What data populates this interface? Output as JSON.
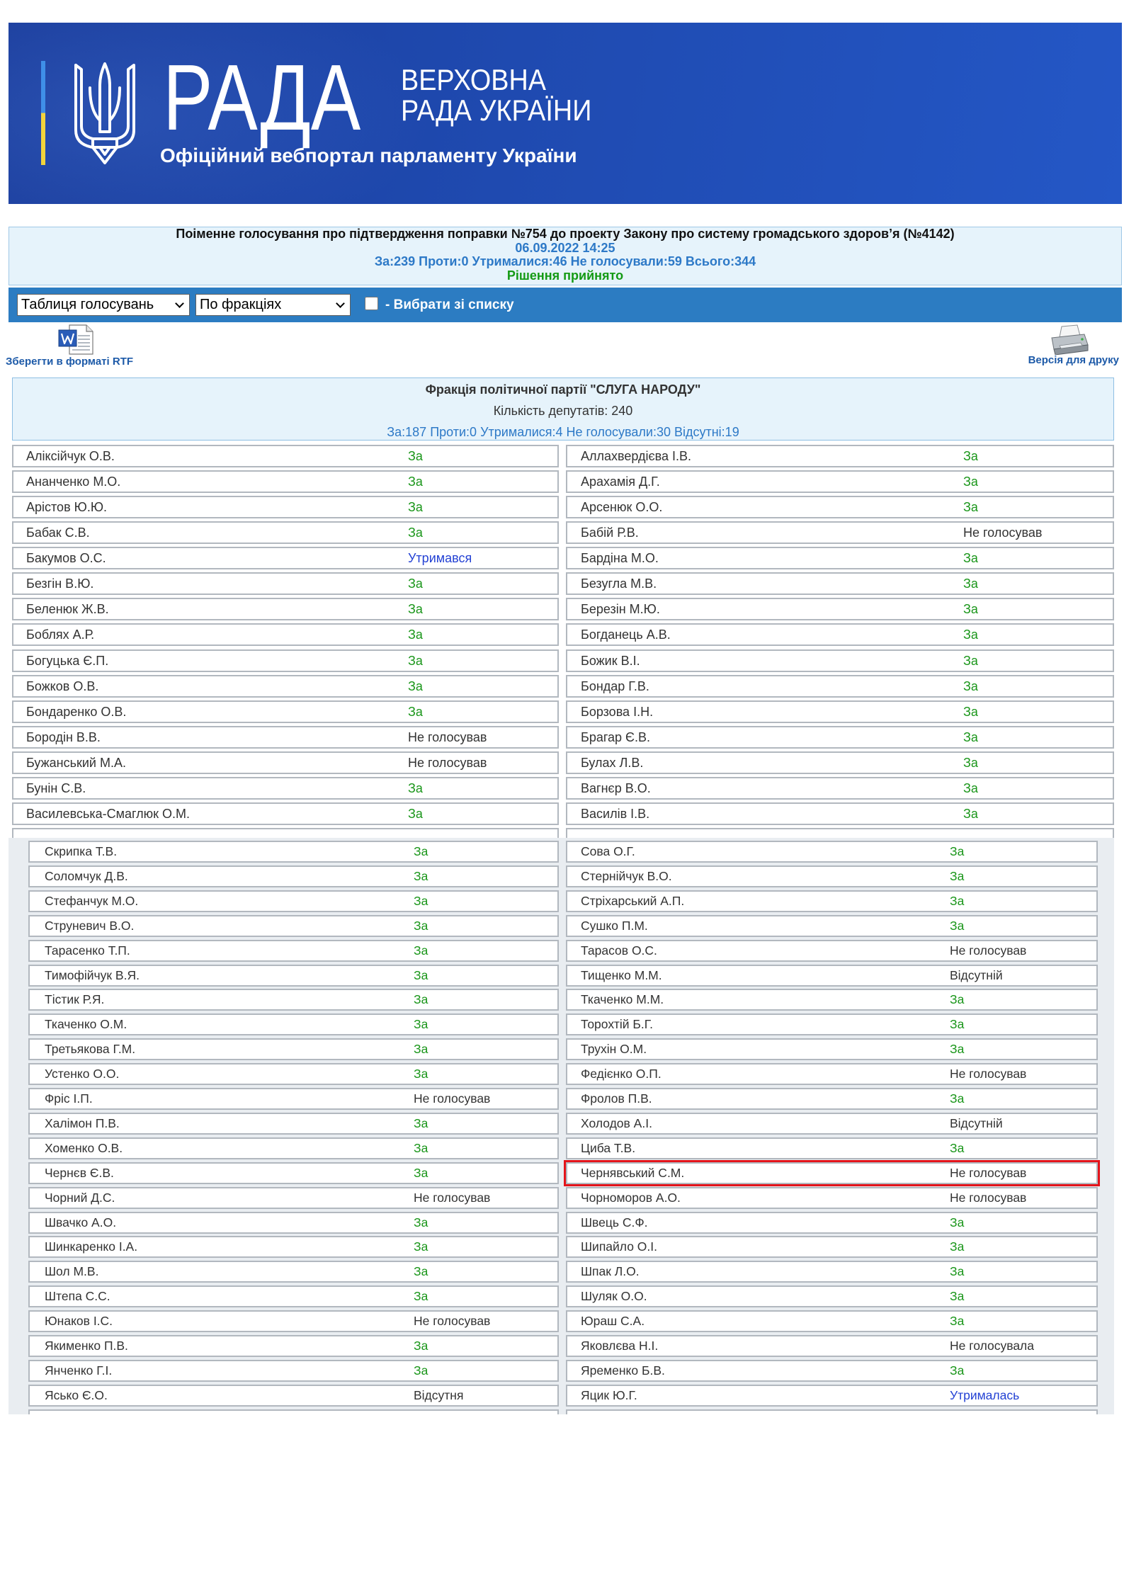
{
  "header": {
    "logo_text": "РАДА",
    "subtitle_line1": "ВЕРХОВНА",
    "subtitle_line2": "РАДА УКРАЇНИ",
    "tagline": "Офіційний вебпортал парламенту України"
  },
  "vote_summary": {
    "title": "Поіменне голосування про підтвердження поправки №754 до проекту Закону про систему громадського здоров’я (№4142)",
    "datetime": "06.09.2022 14:25",
    "totals": "За:239 Проти:0 Утрималися:46 Не голосували:59 Всього:344",
    "decision": "Рішення прийнято"
  },
  "toolbar": {
    "view_select": "Таблиця голосувань",
    "group_select": "По фракціях",
    "choose_label": "- Вибрати зі списку",
    "choose_checked": false
  },
  "actions": {
    "rtf_label": "Зберегти в форматі RTF",
    "print_label": "Версія для друку",
    "rtf_icon": "word-document-icon",
    "print_icon": "printer-icon"
  },
  "faction": {
    "name": "Фракція політичної партії \"СЛУГА НАРОДУ\"",
    "count": "Кількість депутатів: 240",
    "totals": "За:187 Проти:0 Утрималися:4 Не голосували:30 Відсутні:19"
  },
  "colors": {
    "vote_for": "#1a961a",
    "vote_abstain": "#2442d4",
    "vote_other": "#333333",
    "highlight": "#e4141b"
  },
  "rows_top": [
    {
      "ln": "Аліксійчук О.В.",
      "lv": "За",
      "rn": "Аллахвердієва І.В.",
      "rv": "За"
    },
    {
      "ln": "Ананченко М.О.",
      "lv": "За",
      "rn": "Арахамія Д.Г.",
      "rv": "За"
    },
    {
      "ln": "Арістов Ю.Ю.",
      "lv": "За",
      "rn": "Арсенюк О.О.",
      "rv": "За"
    },
    {
      "ln": "Бабак С.В.",
      "lv": "За",
      "rn": "Бабій Р.В.",
      "rv": "Не голосував"
    },
    {
      "ln": "Бакумов О.С.",
      "lv": "Утримався",
      "rn": "Бардіна М.О.",
      "rv": "За"
    },
    {
      "ln": "Безгін В.Ю.",
      "lv": "За",
      "rn": "Безугла М.В.",
      "rv": "За"
    },
    {
      "ln": "Беленюк Ж.В.",
      "lv": "За",
      "rn": "Березін М.Ю.",
      "rv": "За"
    },
    {
      "ln": "Боблях А.Р.",
      "lv": "За",
      "rn": "Богданець А.В.",
      "rv": "За"
    },
    {
      "ln": "Богуцька Є.П.",
      "lv": "За",
      "rn": "Божик В.І.",
      "rv": "За"
    },
    {
      "ln": "Божков О.В.",
      "lv": "За",
      "rn": "Бондар Г.В.",
      "rv": "За"
    },
    {
      "ln": "Бондаренко О.В.",
      "lv": "За",
      "rn": "Борзова І.Н.",
      "rv": "За"
    },
    {
      "ln": "Бородін В.В.",
      "lv": "Не голосував",
      "rn": "Брагар Є.В.",
      "rv": "За"
    },
    {
      "ln": "Бужанський М.А.",
      "lv": "Не голосував",
      "rn": "Булах Л.В.",
      "rv": "За"
    },
    {
      "ln": "Бунін С.В.",
      "lv": "За",
      "rn": "Вагнєр В.О.",
      "rv": "За"
    },
    {
      "ln": "Василевська-Смаглюк О.М.",
      "lv": "За",
      "rn": "Василів І.В.",
      "rv": "За"
    }
  ],
  "rows_bottom": [
    {
      "ln": "Скрипка Т.В.",
      "lv": "За",
      "rn": "Сова О.Г.",
      "rv": "За"
    },
    {
      "ln": "Соломчук Д.В.",
      "lv": "За",
      "rn": "Стернійчук В.О.",
      "rv": "За"
    },
    {
      "ln": "Стефанчук М.О.",
      "lv": "За",
      "rn": "Стріхарський А.П.",
      "rv": "За"
    },
    {
      "ln": "Струневич В.О.",
      "lv": "За",
      "rn": "Сушко П.М.",
      "rv": "За"
    },
    {
      "ln": "Тарасенко Т.П.",
      "lv": "За",
      "rn": "Тарасов О.С.",
      "rv": "Не голосував"
    },
    {
      "ln": "Тимофійчук В.Я.",
      "lv": "За",
      "rn": "Тищенко М.М.",
      "rv": "Відсутній"
    },
    {
      "ln": "Тістик Р.Я.",
      "lv": "За",
      "rn": "Ткаченко М.М.",
      "rv": "За"
    },
    {
      "ln": "Ткаченко О.М.",
      "lv": "За",
      "rn": "Торохтій Б.Г.",
      "rv": "За"
    },
    {
      "ln": "Третьякова Г.М.",
      "lv": "За",
      "rn": "Трухін О.М.",
      "rv": "За"
    },
    {
      "ln": "Устенко О.О.",
      "lv": "За",
      "rn": "Федієнко О.П.",
      "rv": "Не голосував"
    },
    {
      "ln": "Фріс І.П.",
      "lv": "Не голосував",
      "rn": "Фролов П.В.",
      "rv": "За"
    },
    {
      "ln": "Халімон П.В.",
      "lv": "За",
      "rn": "Холодов А.І.",
      "rv": "Відсутній"
    },
    {
      "ln": "Хоменко О.В.",
      "lv": "За",
      "rn": "Циба Т.В.",
      "rv": "За"
    },
    {
      "ln": "Чернєв Є.В.",
      "lv": "За",
      "rn": "Чернявський С.М.",
      "rv": "Не голосував",
      "marked": true
    },
    {
      "ln": "Чорний Д.С.",
      "lv": "Не голосував",
      "rn": "Чорноморов А.О.",
      "rv": "Не голосував"
    },
    {
      "ln": "Швачко А.О.",
      "lv": "За",
      "rn": "Швець С.Ф.",
      "rv": "За"
    },
    {
      "ln": "Шинкаренко І.А.",
      "lv": "За",
      "rn": "Шипайло О.І.",
      "rv": "За"
    },
    {
      "ln": "Шол М.В.",
      "lv": "За",
      "rn": "Шпак Л.О.",
      "rv": "За"
    },
    {
      "ln": "Штепа С.С.",
      "lv": "За",
      "rn": "Шуляк О.О.",
      "rv": "За"
    },
    {
      "ln": "Юнаков І.С.",
      "lv": "Не голосував",
      "rn": "Юраш С.А.",
      "rv": "За"
    },
    {
      "ln": "Якименко П.В.",
      "lv": "За",
      "rn": "Яковлєва Н.І.",
      "rv": "Не голосувала"
    },
    {
      "ln": "Янченко Г.І.",
      "lv": "За",
      "rn": "Яременко Б.В.",
      "rv": "За"
    },
    {
      "ln": "Ясько Є.О.",
      "lv": "Відсутня",
      "rn": "Яцик Ю.Г.",
      "rv": "Утрималась"
    }
  ]
}
